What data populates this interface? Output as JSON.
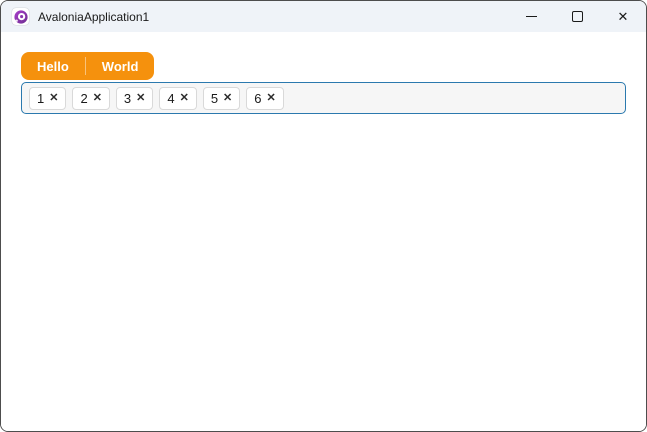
{
  "titlebar": {
    "app_title": "AvaloniaApplication1",
    "close_glyph": "✕"
  },
  "tabs": {
    "items": [
      {
        "label": "Hello"
      },
      {
        "label": "World"
      }
    ]
  },
  "chip_input": {
    "remove_glyph": "✕",
    "chips": [
      {
        "label": "1"
      },
      {
        "label": "2"
      },
      {
        "label": "3"
      },
      {
        "label": "4"
      },
      {
        "label": "5"
      },
      {
        "label": "6"
      }
    ]
  },
  "colors": {
    "accent_orange": "#F5910D",
    "focus_border_blue": "#2B79AE",
    "titlebar_bg": "#EFF3F8",
    "logo_purple": "#8B3DA8",
    "container_bg": "#F6F6F6"
  }
}
